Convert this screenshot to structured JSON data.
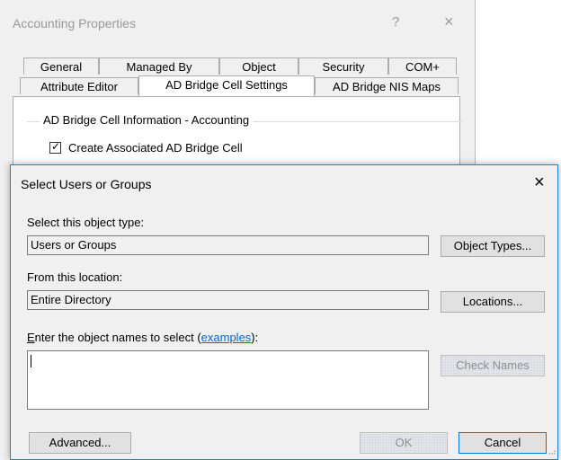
{
  "properties_window": {
    "title": "Accounting Properties",
    "help_glyph": "?",
    "close_glyph": "×",
    "tabs_row1": [
      "General",
      "Managed By",
      "Object",
      "Security",
      "COM+"
    ],
    "tabs_row2": [
      "Attribute Editor",
      "AD Bridge Cell Settings",
      "AD Bridge NIS Maps"
    ],
    "active_tab": "AD Bridge Cell Settings",
    "group_title": "AD Bridge Cell Information - Accounting",
    "create_cell_label": "Create Associated AD Bridge Cell",
    "create_cell_checked": true,
    "check_glyph": "✓"
  },
  "dialog": {
    "title": "Select Users or Groups",
    "close_glyph": "×",
    "object_type_label": "Select this object type:",
    "object_type_value": "Users or Groups",
    "object_types_button": "Object Types...",
    "location_label": "From this location:",
    "location_value": "Entire Directory",
    "locations_button": "Locations...",
    "names_label_accesskey": "E",
    "names_label_rest": "nter the object names to select (",
    "names_label_link": "examples",
    "names_label_end": "):",
    "names_value": "",
    "check_names_button": "Check Names",
    "advanced_button": "Advanced...",
    "ok_button": "OK",
    "cancel_button": "Cancel"
  },
  "colors": {
    "dialog_border": "#1883d7",
    "link": "#0066cc",
    "disabled_text": "#8d8d8d"
  }
}
